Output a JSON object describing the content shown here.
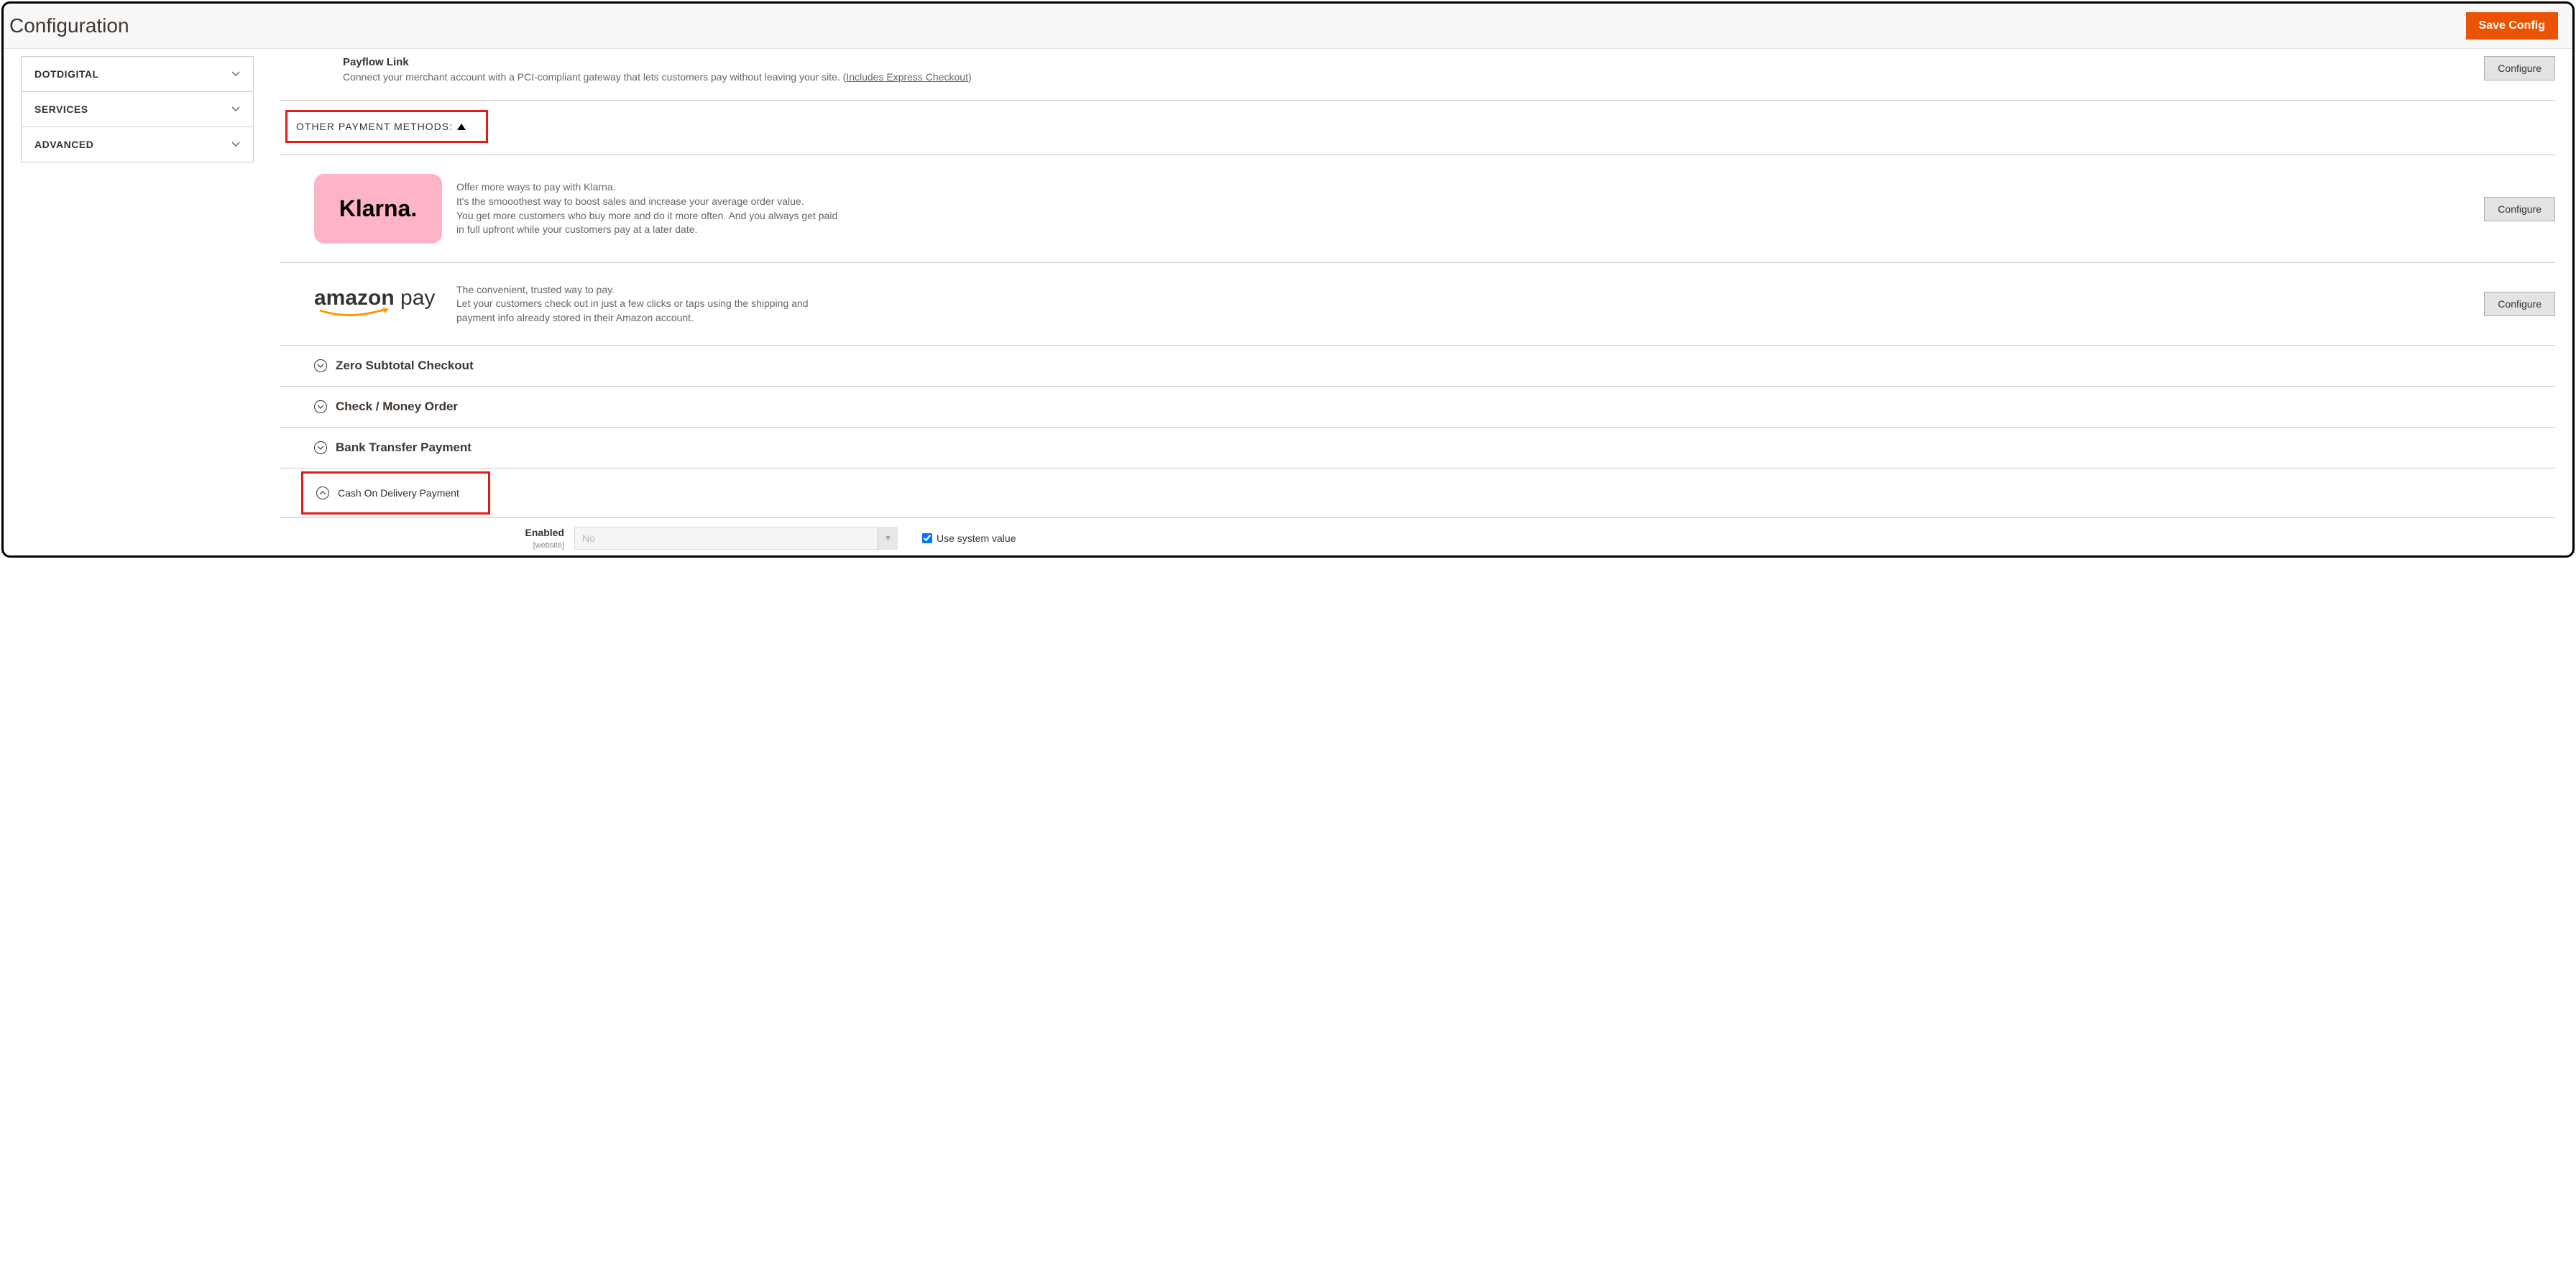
{
  "header": {
    "title": "Configuration",
    "save_button": "Save Config"
  },
  "sidebar": {
    "items": [
      {
        "label": "DOTDIGITAL"
      },
      {
        "label": "SERVICES"
      },
      {
        "label": "ADVANCED"
      }
    ]
  },
  "payflow": {
    "title": "Payflow Link",
    "description_prefix": "Connect your merchant account with a PCI-compliant gateway that lets customers pay without leaving your site. (",
    "link_text": "Includes Express Checkout",
    "description_suffix": ")",
    "configure_button": "Configure"
  },
  "other_methods": {
    "header": "OTHER PAYMENT METHODS:"
  },
  "klarna": {
    "badge_text": "Klarna.",
    "desc_line1": "Offer more ways to pay with Klarna.",
    "desc_line2": "It's the smooothest way to boost sales and increase your average order value.",
    "desc_line3": "You get more customers who buy more and do it more often. And you always get paid in full upfront while your customers pay at a later date.",
    "configure_button": "Configure"
  },
  "amazon": {
    "badge_text1": "amazon",
    "badge_text2": " pay",
    "desc_line1": "The convenient, trusted way to pay.",
    "desc_line2": "Let your customers check out in just a few clicks or taps using the shipping and payment info already stored in their Amazon account.",
    "configure_button": "Configure"
  },
  "collapsibles": {
    "zero_subtotal": "Zero Subtotal Checkout",
    "check_money": "Check / Money Order",
    "bank_transfer": "Bank Transfer Payment",
    "cod": "Cash On Delivery Payment"
  },
  "form": {
    "enabled_label": "Enabled",
    "enabled_scope": "[website]",
    "enabled_value": "No",
    "use_system_label": "Use system value"
  }
}
